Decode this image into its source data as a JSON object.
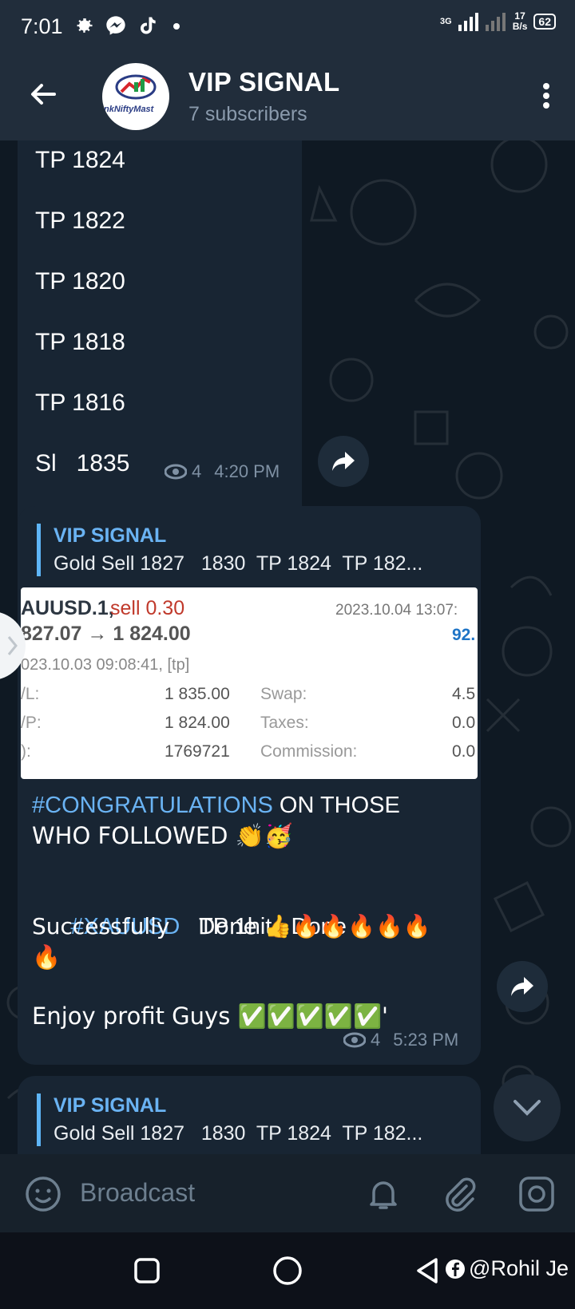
{
  "status_bar": {
    "time": "7:01",
    "network_type": "3G",
    "speed_value": "17",
    "speed_unit": "B/s",
    "battery": "62"
  },
  "header": {
    "title": "VIP SIGNAL",
    "subtitle": "7 subscribers",
    "avatar_text": "nkNiftyMast"
  },
  "messages": {
    "first": {
      "lines": [
        "TP 1824",
        "TP 1822",
        "TP 1820",
        "TP 1818",
        "TP 1816",
        "Sl   1835"
      ],
      "views": "4",
      "time": "4:20 PM"
    },
    "second": {
      "reply_name": "VIP SIGNAL",
      "reply_text": "Gold Sell 1827   1830  TP 1824  TP 182...",
      "image": {
        "symbol": "AUUSD.1,",
        "side": "sell 0.30",
        "date_right": "2023.10.04 13:07:",
        "prices": "827.07 → 1 824.00",
        "profit": "92.",
        "open_date": "023.10.03 09:08:41, [tp]",
        "row1_label": "/L:",
        "row1_value": "1 835.00",
        "row1_label2": "Swap:",
        "row1_value2": "4.5",
        "row2_label": "/P:",
        "row2_value": "1 824.00",
        "row2_label2": "Taxes:",
        "row2_value2": "0.0",
        "row3_label": "):",
        "row3_value": "1769721",
        "row3_label2": "Commission:",
        "row3_value2": "0.0"
      },
      "hashtag1": "#CONGRATULATIONS",
      "text1a": " ON THOSE",
      "text1b": "WHO FOLLOWED  👏🥳",
      "hashtag2": "#XAUUSD",
      "text2a": "   TP 1hit   Done",
      "text2b": "Successfully    Done 👍🔥🔥🔥🔥🔥",
      "text2c": "🔥",
      "text3": "Enjoy profit Guys ✅✅✅✅✅'",
      "views": "4",
      "time": "5:23 PM"
    },
    "third": {
      "reply_name": "VIP SIGNAL",
      "reply_text": "Gold Sell 1827   1830  TP 1824  TP 182..."
    }
  },
  "input": {
    "placeholder": "Broadcast"
  },
  "watermark": "@Rohil Je"
}
